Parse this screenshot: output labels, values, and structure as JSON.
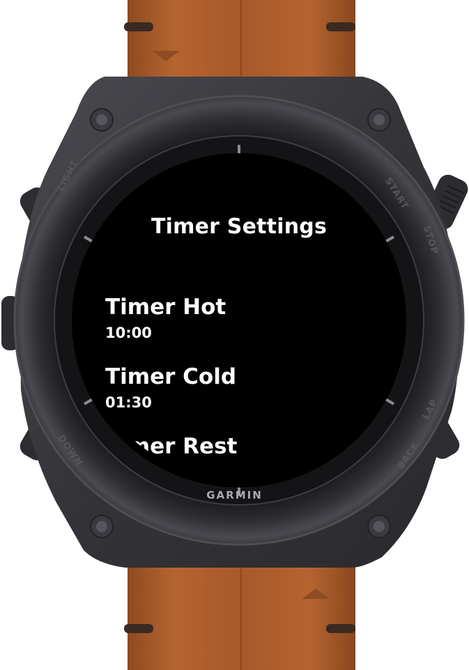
{
  "device": {
    "brand": "GARMIN",
    "buttons": {
      "light": "LIGHT",
      "start": "START",
      "stop": "STOP",
      "lap": "LAP",
      "back": "BACK",
      "down": "DOWN"
    }
  },
  "screen": {
    "title": "Timer Settings",
    "items": [
      {
        "label": "Timer Hot",
        "value": "10:00"
      },
      {
        "label": "Timer Cold",
        "value": "01:30"
      },
      {
        "label": "Timer Rest",
        "value": ""
      }
    ]
  },
  "colors": {
    "strap": "#a85a2a",
    "case": "#3a3a3f",
    "bezel": "#2c2c30",
    "screen": "#000000",
    "text": "#ffffff"
  }
}
